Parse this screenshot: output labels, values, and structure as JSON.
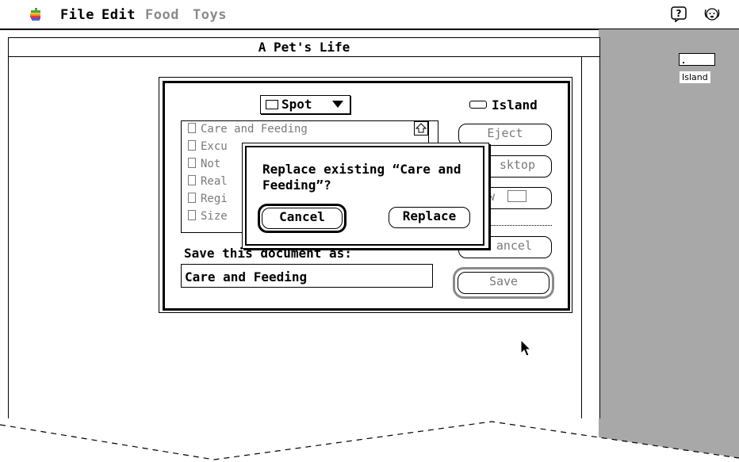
{
  "menubar": {
    "items": [
      {
        "label": "File",
        "state": "normal"
      },
      {
        "label": "Edit",
        "state": "active"
      },
      {
        "label": "Food",
        "state": "dim"
      },
      {
        "label": "Toys",
        "state": "dim"
      }
    ],
    "icons": [
      "apple-icon",
      "help-icon",
      "dog-icon"
    ]
  },
  "desktop": {
    "disk_label": "Island"
  },
  "window": {
    "title": "A Pet's Life"
  },
  "save_dialog": {
    "folder_popup": "Spot",
    "volume": "Island",
    "files": [
      "Care and Feeding",
      "Excu",
      "Not",
      "Real",
      "Regi",
      "Size"
    ],
    "buttons": {
      "eject": "Eject",
      "desktop": "sktop",
      "new": "w",
      "cancel": "ancel",
      "save": "Save"
    },
    "save_as_label": "Save this document as:",
    "filename_value": "Care and Feeding"
  },
  "alert": {
    "message": "Replace existing “Care and Feeding”?",
    "cancel": "Cancel",
    "replace": "Replace"
  },
  "colors": {
    "desktop": "#a8a8a8",
    "dim_text": "#7a7a7a"
  }
}
